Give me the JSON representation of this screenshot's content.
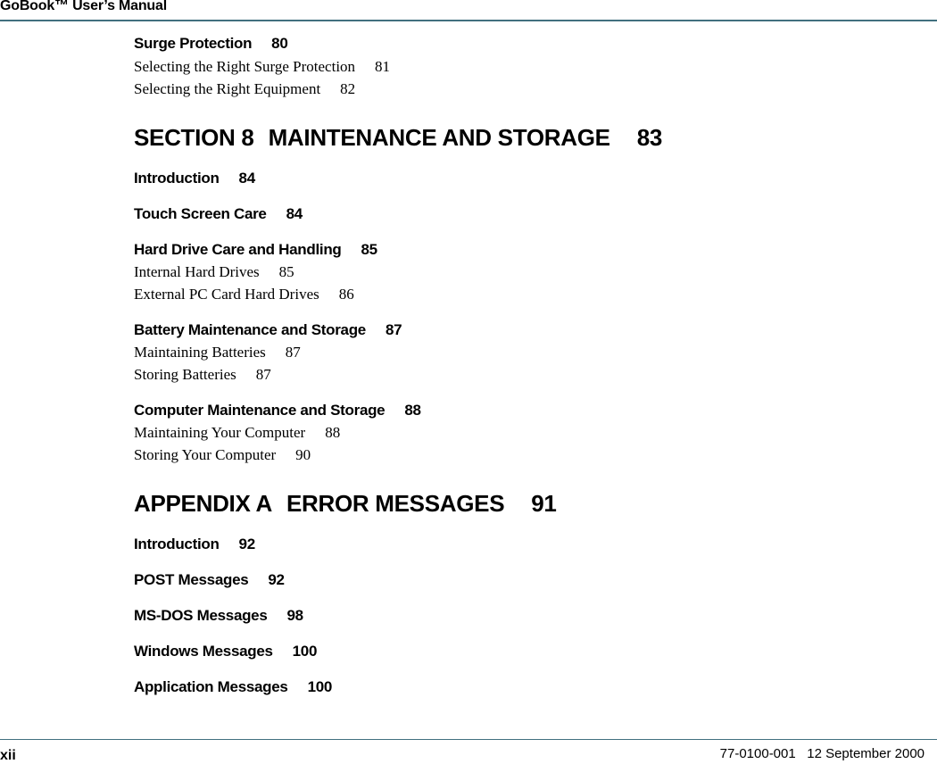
{
  "header": {
    "title": "GoBook™ User’s Manual"
  },
  "toc": [
    {
      "level": 2,
      "title": "Surge Protection",
      "page": "80"
    },
    {
      "level": 3,
      "title": "Selecting the Right Surge Protection",
      "page": "81"
    },
    {
      "level": 3,
      "title": "Selecting the Right Equipment",
      "page": "82"
    },
    {
      "level": 1,
      "section": "SECTION 8",
      "title": "MAINTENANCE AND STORAGE",
      "page": "83"
    },
    {
      "level": 2,
      "title": "Introduction",
      "page": "84"
    },
    {
      "level": 2,
      "title": "Touch Screen Care",
      "page": "84"
    },
    {
      "level": 2,
      "title": "Hard Drive Care and Handling",
      "page": "85"
    },
    {
      "level": 3,
      "title": "Internal Hard Drives",
      "page": "85"
    },
    {
      "level": 3,
      "title": "External PC Card Hard Drives",
      "page": "86"
    },
    {
      "level": 2,
      "title": "Battery Maintenance and Storage",
      "page": "87"
    },
    {
      "level": 3,
      "title": "Maintaining Batteries",
      "page": "87"
    },
    {
      "level": 3,
      "title": "Storing Batteries",
      "page": "87"
    },
    {
      "level": 2,
      "title": "Computer Maintenance and Storage",
      "page": "88"
    },
    {
      "level": 3,
      "title": "Maintaining Your Computer",
      "page": "88"
    },
    {
      "level": 3,
      "title": "Storing Your Computer",
      "page": "90"
    },
    {
      "level": 1,
      "section": "APPENDIX A",
      "title": "ERROR MESSAGES",
      "page": "91"
    },
    {
      "level": 2,
      "title": "Introduction",
      "page": "92"
    },
    {
      "level": 2,
      "title": "POST Messages",
      "page": "92"
    },
    {
      "level": 2,
      "title": "MS-DOS Messages",
      "page": "98"
    },
    {
      "level": 2,
      "title": "Windows Messages",
      "page": "100"
    },
    {
      "level": 2,
      "title": "Application Messages",
      "page": "100"
    }
  ],
  "footer": {
    "page_number": "xii",
    "doc_id": "77-0100-001",
    "date": "12 September 2000"
  },
  "colors": {
    "rule": "#41707f",
    "text": "#000000"
  }
}
